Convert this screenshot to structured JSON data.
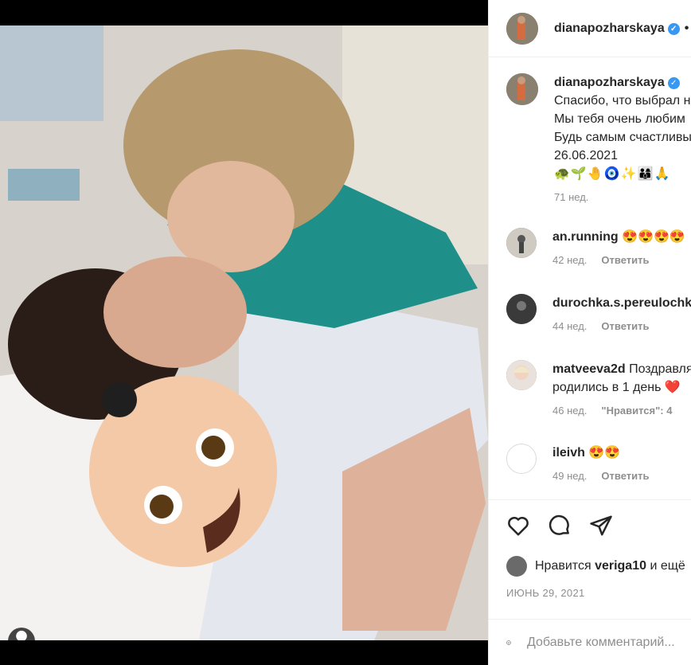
{
  "post": {
    "author": "dianapozharskaya",
    "photo_carousel": {
      "count": 2,
      "active_index": 0
    }
  },
  "caption": {
    "username": "dianapozharskaya",
    "lines": [
      "Спасибо, что выбрал нас",
      "Мы тебя очень любим",
      "Будь самым счастливым",
      "26.06.2021"
    ],
    "emojis": "🐢🌱🤚🧿✨👨‍👩‍👦🙏",
    "time": "71 нед."
  },
  "comments": [
    {
      "username": "an.running",
      "text": "😍😍😍😍",
      "time": "42 нед.",
      "action": "Ответить"
    },
    {
      "username": "durochka.s.pereulochka",
      "text": "",
      "time": "44 нед.",
      "action": "Ответить"
    },
    {
      "username": "matveeva2d",
      "text": "Поздравляю! Мы с вами",
      "text2": "родились в 1 день ❤️",
      "time": "46 нед.",
      "action": "\"Нравится\": 4"
    },
    {
      "username": "ileivh",
      "text": "😍😍",
      "time": "49 нед.",
      "action": "Ответить"
    }
  ],
  "likes": {
    "prefix": "Нравится",
    "user": "veriga10",
    "suffix": "и ещё"
  },
  "date": "ИЮНЬ 29, 2021",
  "add_comment": {
    "placeholder": "Добавьте комментарий..."
  },
  "colors": {
    "accent": "#3897f0",
    "text": "#262626",
    "muted": "#8e8e8e"
  }
}
